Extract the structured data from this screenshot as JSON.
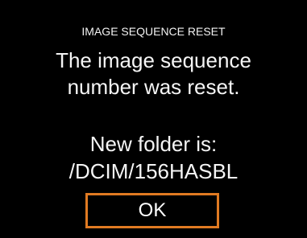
{
  "dialog": {
    "title": "IMAGE SEQUENCE RESET",
    "message_line1": "The image sequence",
    "message_line2": "number was reset.",
    "folder_label": "New folder is:",
    "folder_path": "/DCIM/156HASBL",
    "ok_label": "OK"
  },
  "colors": {
    "background": "#000000",
    "text": "#ffffff",
    "focus_border": "#e07a22"
  }
}
